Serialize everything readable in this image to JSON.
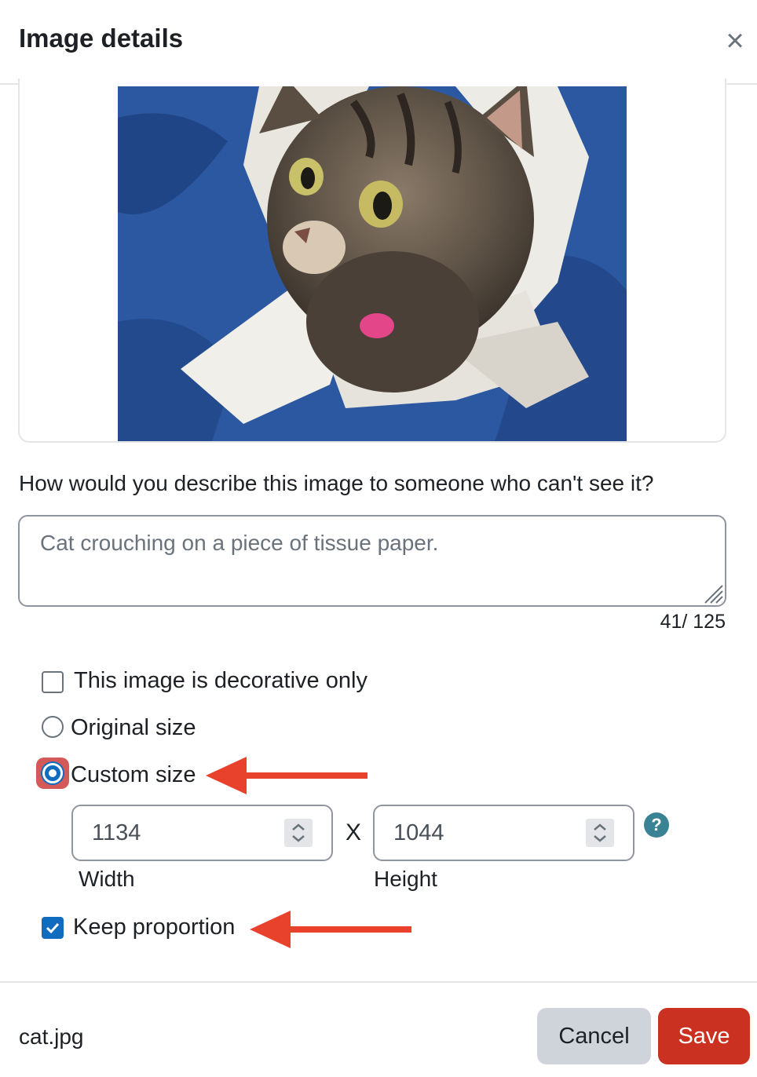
{
  "dialog": {
    "title": "Image details",
    "close_icon": "close-icon"
  },
  "image": {
    "alt": "Cat crouching on a piece of tissue paper."
  },
  "description": {
    "question": "How would you describe this image to someone who can't see it?",
    "value": "Cat crouching on a piece of tissue paper.",
    "counter": "41/ 125"
  },
  "options": {
    "decorative_label": "This image is decorative only",
    "decorative_checked": false,
    "original_size_label": "Original size",
    "custom_size_label": "Custom size",
    "selected_size": "custom",
    "width_value": "1134",
    "height_value": "1044",
    "times": "X",
    "width_label": "Width",
    "height_label": "Height",
    "help_glyph": "?",
    "keep_proportion_label": "Keep proportion",
    "keep_proportion_checked": true
  },
  "footer": {
    "filename": "cat.jpg",
    "cancel_label": "Cancel",
    "save_label": "Save"
  },
  "colors": {
    "primary": "#0f6cbf",
    "danger": "#ca3120",
    "annotation_arrow": "#e8412c",
    "help": "#3a8394"
  }
}
